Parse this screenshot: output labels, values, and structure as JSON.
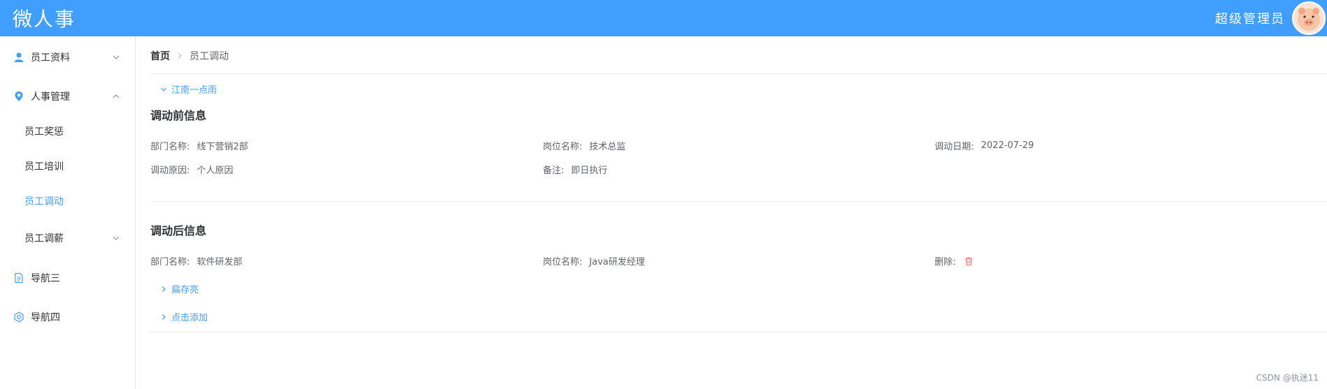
{
  "header": {
    "brand": "微人事",
    "user_name": "超级管理员",
    "avatar_icon": "avatar-pig"
  },
  "sidebar": {
    "items": [
      {
        "label": "员工资料",
        "icon": "user-icon",
        "expanded": false
      },
      {
        "label": "人事管理",
        "icon": "location-icon",
        "expanded": true
      },
      {
        "label": "员工奖惩"
      },
      {
        "label": "员工培训"
      },
      {
        "label": "员工调动",
        "active": true
      },
      {
        "label": "员工调薪"
      },
      {
        "label": "导航三",
        "icon": "document-icon"
      },
      {
        "label": "导航四",
        "icon": "gear-icon"
      }
    ]
  },
  "breadcrumb": {
    "home": "首页",
    "current": "员工调动"
  },
  "employee_panel": {
    "name": "江南一点雨",
    "before": {
      "title": "调动前信息",
      "dept_label": "部门名称:",
      "dept_value": "线下营销2部",
      "job_label": "岗位名称:",
      "job_value": "技术总监",
      "date_label": "调动日期:",
      "date_value": "2022-07-29",
      "reason_label": "调动原因:",
      "reason_value": "个人原因",
      "remark_label": "备注:",
      "remark_value": "即日执行"
    },
    "after": {
      "title": "调动后信息",
      "dept_label": "部门名称:",
      "dept_value": "软件研发部",
      "job_label": "岗位名称:",
      "job_value": "Java研发经理",
      "delete_label": "删除:"
    }
  },
  "collapsed_items": [
    {
      "name": "扁存亮"
    },
    {
      "name": "点击添加"
    }
  ],
  "watermark": "CSDN @执迷11",
  "colors": {
    "primary": "#409eff",
    "danger": "#f56c6c",
    "text": "#303133",
    "border": "#ebeef5"
  }
}
